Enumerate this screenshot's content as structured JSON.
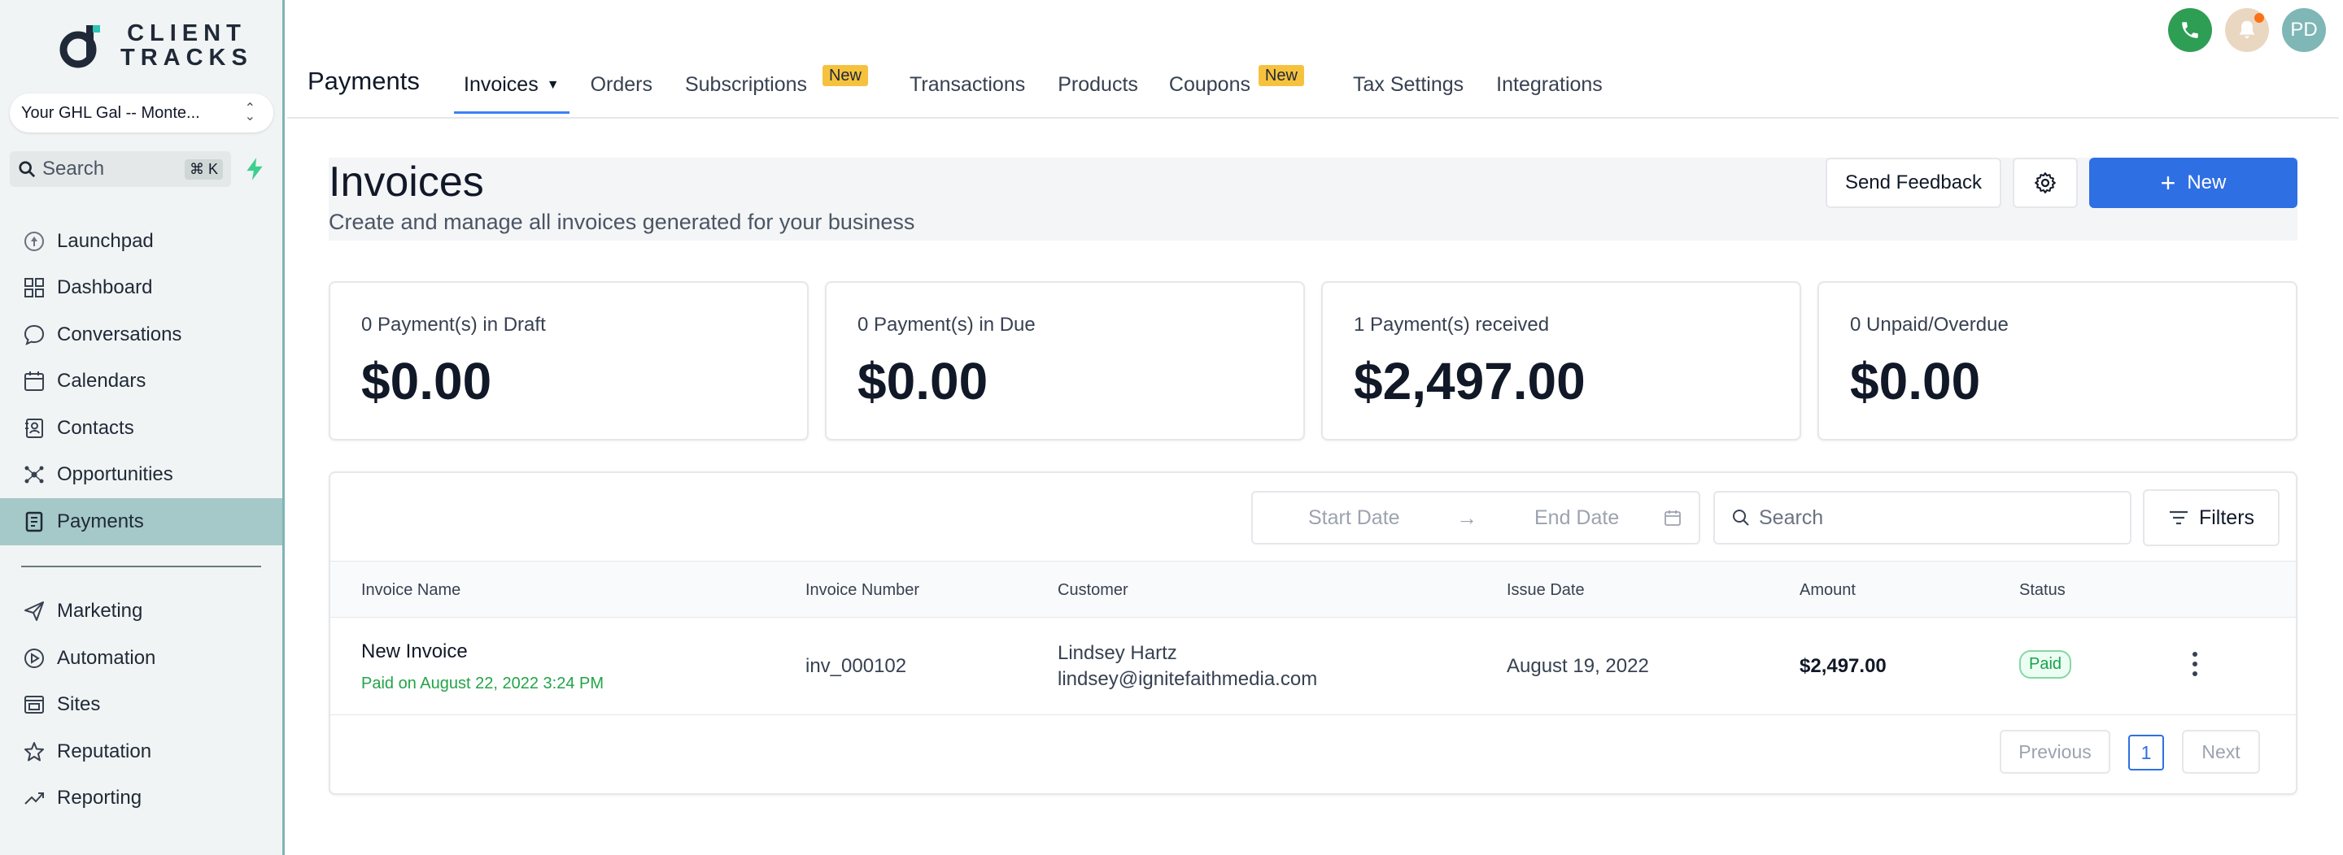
{
  "brand": {
    "line1": "CLIENT",
    "line2": "TRACKS"
  },
  "account": {
    "name": "Your GHL Gal -- Monte..."
  },
  "sidebar_search": {
    "placeholder": "Search",
    "shortcut": "⌘ K"
  },
  "nav": {
    "items": [
      {
        "label": "Launchpad",
        "icon": "launchpad-icon"
      },
      {
        "label": "Dashboard",
        "icon": "dashboard-icon"
      },
      {
        "label": "Conversations",
        "icon": "chat-icon"
      },
      {
        "label": "Calendars",
        "icon": "calendar-icon"
      },
      {
        "label": "Contacts",
        "icon": "contacts-icon"
      },
      {
        "label": "Opportunities",
        "icon": "opportunities-icon"
      },
      {
        "label": "Payments",
        "icon": "payments-icon",
        "active": true
      }
    ],
    "secondary": [
      {
        "label": "Marketing",
        "icon": "send-icon"
      },
      {
        "label": "Automation",
        "icon": "automation-icon"
      },
      {
        "label": "Sites",
        "icon": "sites-icon"
      },
      {
        "label": "Reputation",
        "icon": "star-icon"
      },
      {
        "label": "Reporting",
        "icon": "trend-icon"
      }
    ]
  },
  "header": {
    "title": "Payments",
    "tabs": [
      {
        "label": "Invoices",
        "active": true
      },
      {
        "label": "Orders"
      },
      {
        "label": "Subscriptions",
        "badge": "New"
      },
      {
        "label": "Transactions"
      },
      {
        "label": "Products"
      },
      {
        "label": "Coupons",
        "badge": "New"
      },
      {
        "label": "Tax Settings"
      },
      {
        "label": "Integrations"
      }
    ],
    "avatar_initials": "PD"
  },
  "page": {
    "title": "Invoices",
    "subtitle": "Create and manage all invoices generated for your business",
    "feedback_label": "Send Feedback",
    "new_label": "New"
  },
  "summary_cards": [
    {
      "label": "0 Payment(s) in Draft",
      "value": "$0.00"
    },
    {
      "label": "0 Payment(s) in Due",
      "value": "$0.00"
    },
    {
      "label": "1 Payment(s) received",
      "value": "$2,497.00"
    },
    {
      "label": "0 Unpaid/Overdue",
      "value": "$0.00"
    }
  ],
  "filters": {
    "start_placeholder": "Start Date",
    "end_placeholder": "End Date",
    "search_placeholder": "Search",
    "filters_label": "Filters"
  },
  "table": {
    "columns": [
      "Invoice Name",
      "Invoice Number",
      "Customer",
      "Issue Date",
      "Amount",
      "Status"
    ],
    "rows": [
      {
        "name": "New Invoice",
        "paid_note": "Paid on August 22, 2022 3:24 PM",
        "number": "inv_000102",
        "customer_name": "Lindsey Hartz",
        "customer_email": "lindsey@ignitefaithmedia.com",
        "issue_date": "August 19, 2022",
        "amount": "$2,497.00",
        "status": "Paid"
      }
    ]
  },
  "pagination": {
    "previous": "Previous",
    "page": "1",
    "next": "Next"
  },
  "colors": {
    "accent": "#2f6fe4",
    "sidebar_active": "#a5c8c8",
    "paid": "#16a34a",
    "badge": "#f6c23e"
  }
}
